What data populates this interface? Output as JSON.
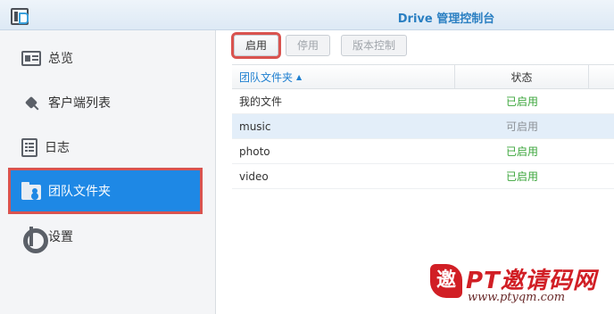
{
  "window": {
    "title": "Drive 管理控制台",
    "app_icon": "synology-drive-icon"
  },
  "sidebar": {
    "items": [
      {
        "label": "总览",
        "icon": "overview-icon",
        "active": false
      },
      {
        "label": "客户端列表",
        "icon": "plug-icon",
        "active": false
      },
      {
        "label": "日志",
        "icon": "log-icon",
        "active": false
      },
      {
        "label": "团队文件夹",
        "icon": "team-folder-icon",
        "active": true
      },
      {
        "label": "设置",
        "icon": "gear-icon",
        "active": false
      }
    ]
  },
  "toolbar": {
    "enable_label": "启用",
    "disable_label": "停用",
    "version_label": "版本控制"
  },
  "table": {
    "headers": {
      "name": "团队文件夹",
      "status": "状态"
    },
    "rows": [
      {
        "name": "我的文件",
        "status": "已启用"
      },
      {
        "name": "music",
        "status": "可启用"
      },
      {
        "name": "photo",
        "status": "已启用"
      },
      {
        "name": "video",
        "status": "已启用"
      }
    ]
  },
  "watermark": {
    "logo_char": "邀",
    "text": "PT邀请码网",
    "url": "www.ptyqm.com"
  },
  "colors": {
    "accent": "#1e88e5",
    "highlight_border": "#d9534f",
    "enabled_status": "#3aa53a",
    "title": "#2a7fc2"
  }
}
